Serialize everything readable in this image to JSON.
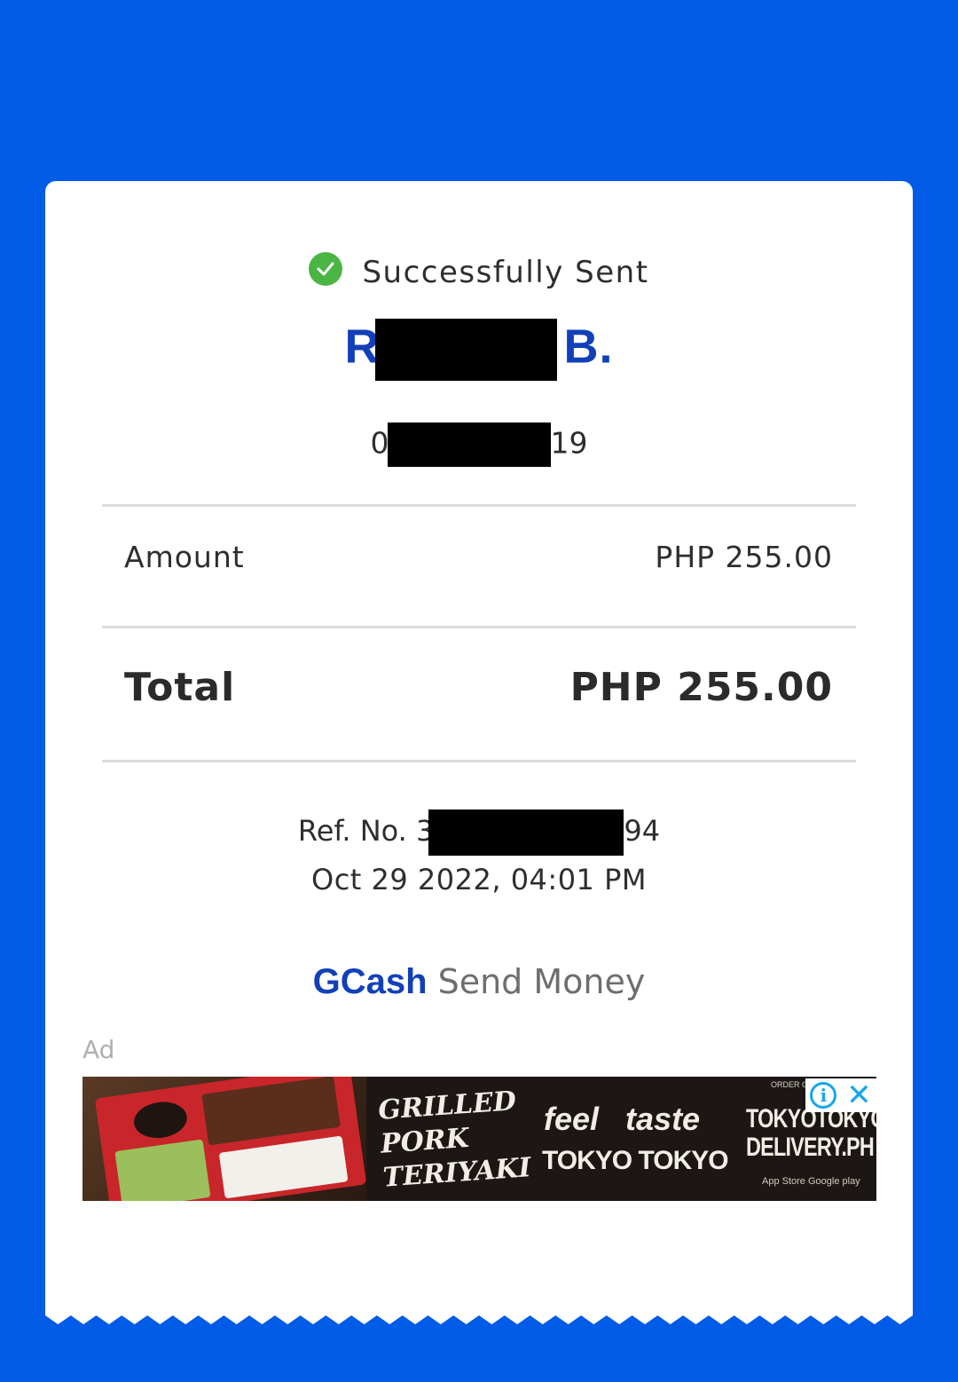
{
  "status": {
    "text": "Successfully Sent",
    "icon": "check-circle-icon",
    "color": "#4bb543"
  },
  "recipient": {
    "name_prefix": "R",
    "name_suffix": "B.",
    "phone_prefix": "0",
    "phone_suffix": "19"
  },
  "amount": {
    "label": "Amount",
    "value": "PHP 255.00"
  },
  "total": {
    "label": "Total",
    "value": "PHP 255.00"
  },
  "reference": {
    "prefix": "Ref. No. 3",
    "suffix": "94",
    "datetime": "Oct 29 2022, 04:01 PM"
  },
  "brand": {
    "name": "GCash",
    "service": "Send Money",
    "color": "#1140b8"
  },
  "ad": {
    "label": "Ad",
    "dish_text": "GRILLED\nPORK\nTERIYAKI",
    "slogan_line1": "feel   taste",
    "slogan_line2": "TOKYO TOKYO",
    "order_text": "TOKYOTOKYO\nDELIVERY.PH",
    "order_small": "ORDER ON",
    "stores_text": "App Store   Google play",
    "info_icon": "info-icon",
    "close_icon": "close-icon"
  },
  "colors": {
    "background": "#005ce6",
    "receipt": "#ffffff",
    "divider": "#dcdcdc"
  }
}
